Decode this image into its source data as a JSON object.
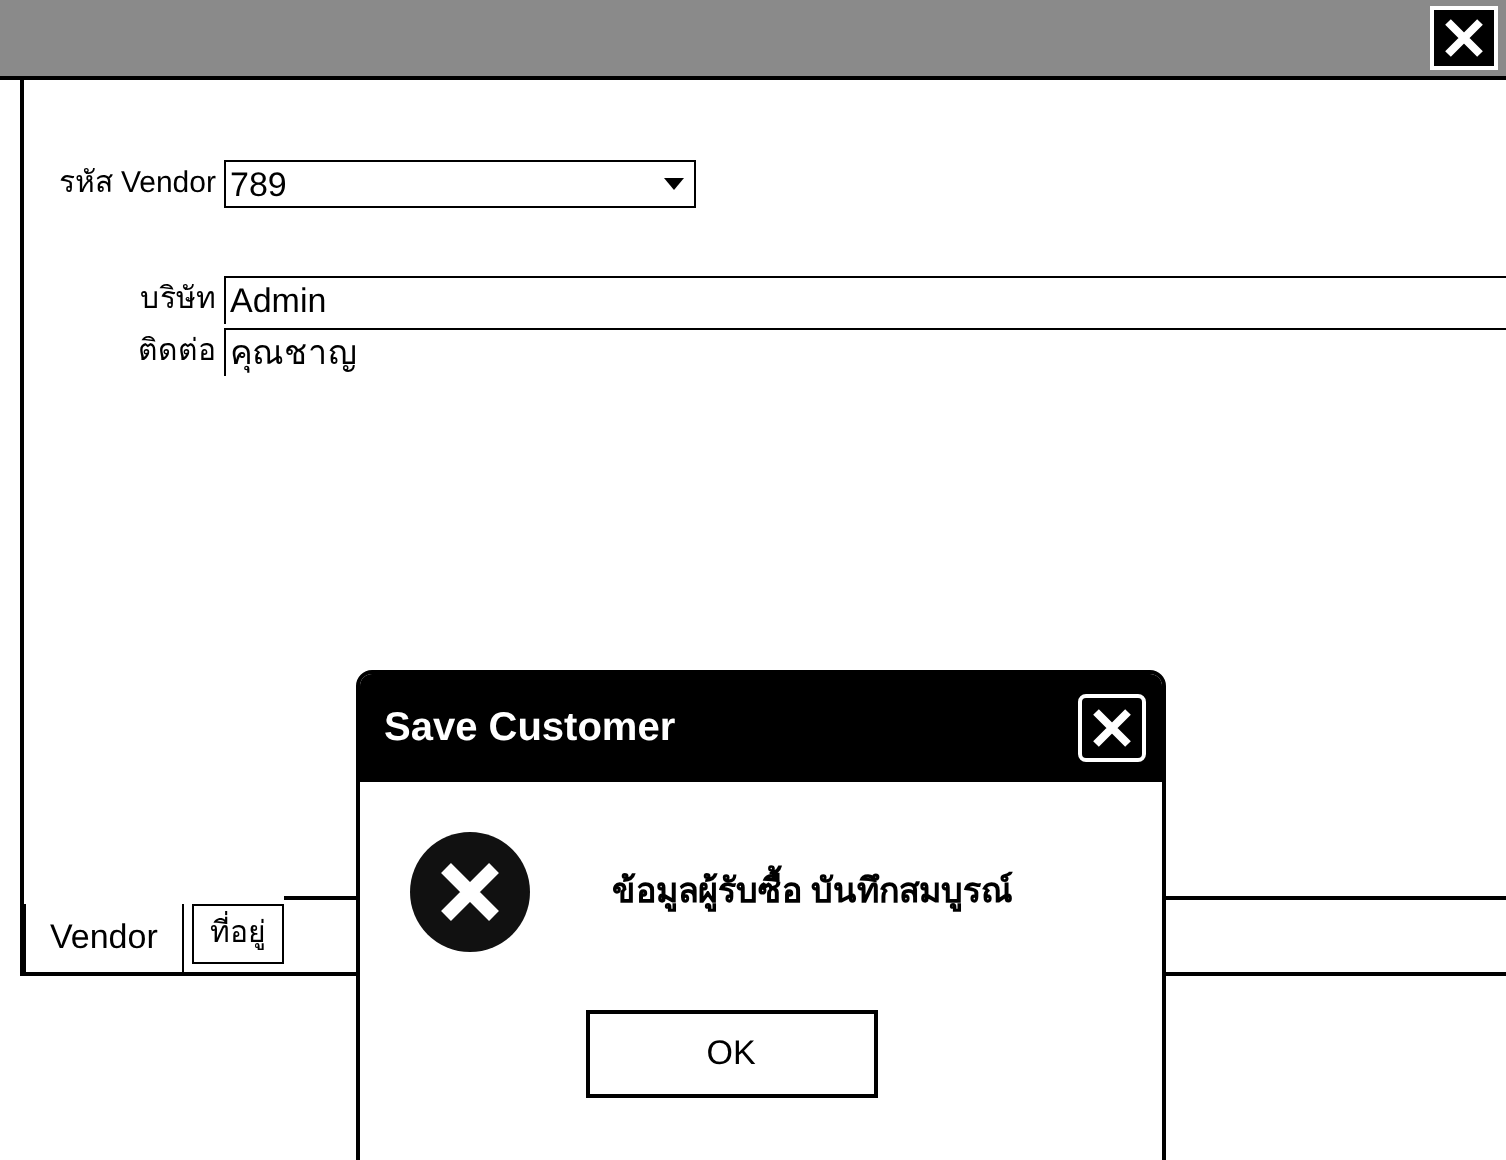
{
  "form": {
    "fields": [
      {
        "label": "รหัส Vendor",
        "value": "789",
        "kind": "dropdown"
      },
      {
        "label": "บริษัท",
        "value": "Admin",
        "kind": "text"
      },
      {
        "label": "ติดต่อ",
        "value": "คุณชาญ",
        "kind": "text"
      }
    ]
  },
  "tabs": [
    {
      "label": "Vendor",
      "selected": true
    },
    {
      "label": "ที่อยู่",
      "selected": false
    }
  ],
  "dialog": {
    "title": "Save Customer",
    "message": "ข้อมูลผู้รับซื้อ บันทึกสมบูรณ์",
    "kind": "error",
    "buttons": [
      "OK"
    ]
  }
}
